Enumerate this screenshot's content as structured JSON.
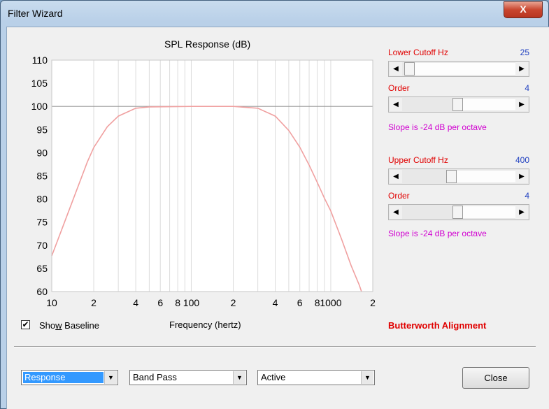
{
  "window": {
    "title": "Filter Wizard",
    "close_glyph": "X"
  },
  "chart_data": {
    "type": "line",
    "title": "SPL Response (dB)",
    "xlabel": "Frequency (hertz)",
    "ylabel": "",
    "x_scale": "log",
    "xlim": [
      10,
      2000
    ],
    "ylim": [
      60,
      110
    ],
    "y_ticks": [
      60,
      65,
      70,
      75,
      80,
      85,
      90,
      95,
      100,
      105,
      110
    ],
    "x_tick_labels": [
      {
        "x": 10,
        "label": "10"
      },
      {
        "x": 20,
        "label": "2"
      },
      {
        "x": 40,
        "label": "4"
      },
      {
        "x": 60,
        "label": "6"
      },
      {
        "x": 80,
        "label": "8"
      },
      {
        "x": 100,
        "label": "100"
      },
      {
        "x": 200,
        "label": "2"
      },
      {
        "x": 400,
        "label": "4"
      },
      {
        "x": 600,
        "label": "6"
      },
      {
        "x": 800,
        "label": "8"
      },
      {
        "x": 1000,
        "label": "1000"
      },
      {
        "x": 2000,
        "label": "2"
      }
    ],
    "grid": true,
    "baseline": 100,
    "series": [
      {
        "color": "#f0a0a0",
        "points": [
          [
            10,
            67.7
          ],
          [
            12,
            74.0
          ],
          [
            15,
            81.7
          ],
          [
            18,
            88.0
          ],
          [
            20,
            91.1
          ],
          [
            25,
            95.6
          ],
          [
            30,
            97.9
          ],
          [
            40,
            99.6
          ],
          [
            50,
            99.9
          ],
          [
            100,
            100.0
          ],
          [
            200,
            100.0
          ],
          [
            300,
            99.6
          ],
          [
            400,
            97.9
          ],
          [
            500,
            94.8
          ],
          [
            600,
            91.2
          ],
          [
            700,
            87.3
          ],
          [
            800,
            83.6
          ],
          [
            900,
            80.2
          ],
          [
            1000,
            77.4
          ],
          [
            1200,
            71.2
          ],
          [
            1400,
            65.6
          ],
          [
            1600,
            61.4
          ],
          [
            1660,
            60.0
          ]
        ]
      }
    ]
  },
  "controls": {
    "lower_cutoff_label": "Lower Cutoff  Hz",
    "lower_cutoff_value": "25",
    "lower_cutoff_position": 0.02,
    "lower_order_label": "Order",
    "lower_order_value": "4",
    "lower_order_position": 0.49,
    "lower_slope": "Slope is -24 dB per octave",
    "upper_cutoff_label": "Upper Cutoff  Hz",
    "upper_cutoff_value": "400",
    "upper_cutoff_position": 0.43,
    "upper_order_label": "Order",
    "upper_order_value": "4",
    "upper_order_position": 0.49,
    "upper_slope": "Slope is -24 dB per octave",
    "alignment": "Butterworth Alignment"
  },
  "show_baseline": {
    "label_pre": "Sho",
    "label_u": "w",
    "label_post": " Baseline",
    "checked": true,
    "check_glyph": "✔"
  },
  "footer": {
    "view_select": "Response",
    "filter_type_select": "Band Pass",
    "mode_select": "Active",
    "close_label": "Close",
    "arrow_glyph": "▼"
  },
  "glyphs": {
    "left_arrow": "◀",
    "right_arrow": "▶"
  },
  "colors": {
    "curve": "#f0a0a0",
    "red_label": "#e00000",
    "blue_value": "#2040c0",
    "slope_text": "#d000d0",
    "selection": "#3399ff"
  }
}
